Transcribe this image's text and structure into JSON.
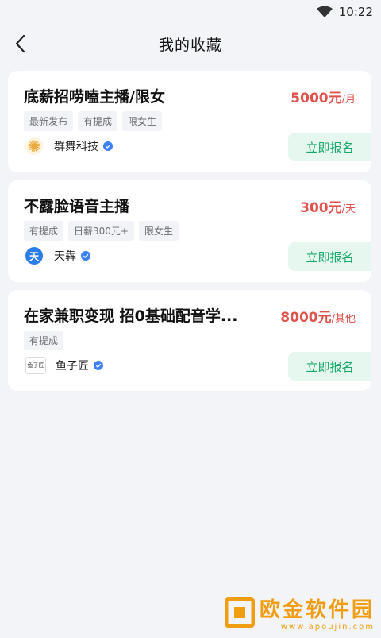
{
  "status_bar": {
    "time": "10:22"
  },
  "header": {
    "title": "我的收藏"
  },
  "jobs": [
    {
      "title": "底薪招唠嗑主播/限女",
      "salary": "5000元",
      "unit": "/月",
      "tags": [
        "最新发布",
        "有提成",
        "限女生"
      ],
      "company": "群舞科技",
      "button": "立即报名"
    },
    {
      "title": "不露脸语音主播",
      "salary": "300元",
      "unit": "/天",
      "tags": [
        "有提成",
        "日薪300元+",
        "限女生"
      ],
      "company": "天犇",
      "logo_text": "天",
      "button": "立即报名"
    },
    {
      "title": "在家兼职变现 招0基础配音学...",
      "salary": "8000元",
      "unit": "/其他",
      "tags": [
        "有提成"
      ],
      "company": "鱼子匠",
      "logo_text": "鱼子匠",
      "button": "立即报名"
    }
  ],
  "watermark": {
    "main": "欧金软件园",
    "sub": "www.apoujin.com"
  },
  "colors": {
    "salary": "#e0524c",
    "apply_bg": "#e6f7f0",
    "apply_text": "#18a86a",
    "verified": "#3b82f6",
    "watermark": "#f19d11"
  }
}
